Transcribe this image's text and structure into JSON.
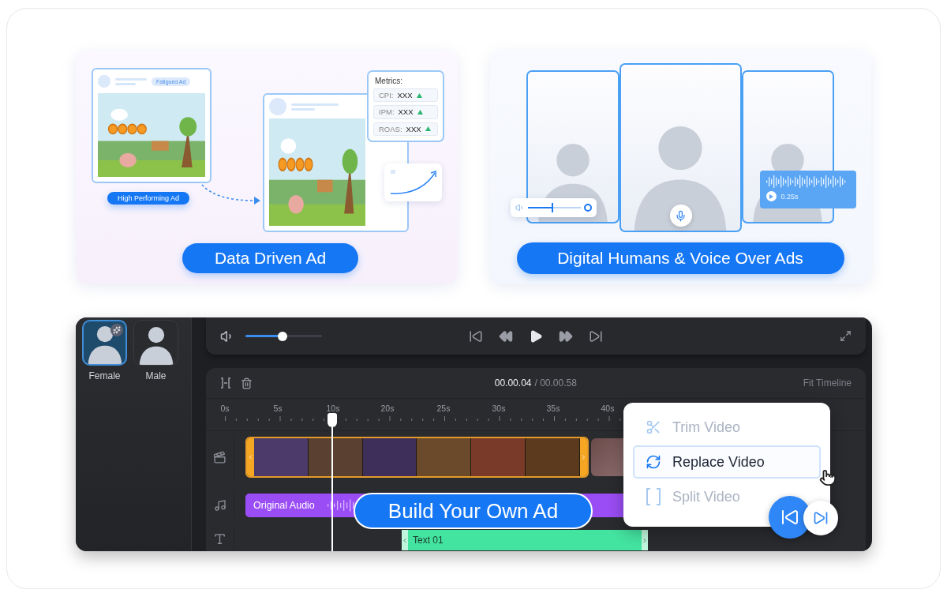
{
  "data_driven_card": {
    "fatigued_tag": "Fatigued Ad",
    "high_performing_label": "High Performing Ad",
    "metrics": {
      "title": "Metrics:",
      "rows": [
        {
          "label": "CPI:",
          "value": "XXX"
        },
        {
          "label": "IPM:",
          "value": "XXX"
        },
        {
          "label": "ROAS:",
          "value": "XXX"
        }
      ]
    },
    "button": "Data Driven Ad"
  },
  "digital_humans_card": {
    "volume": {
      "level": 0.45
    },
    "voice_duration": "0.25s",
    "button": "Digital Humans & Voice Over Ads"
  },
  "editor": {
    "avatars": [
      {
        "label": "Female",
        "selected": true
      },
      {
        "label": "Male",
        "selected": false
      }
    ],
    "player": {
      "volume": {
        "level": 0.48
      }
    },
    "timeline": {
      "current_time": "00.00.04",
      "total_time": "/ 00.00.58",
      "fit_label": "Fit Timeline",
      "ruler": [
        "0s",
        "5s",
        "10s",
        "20s",
        "25s",
        "30s",
        "35s",
        "40s"
      ],
      "tracks": [
        {
          "kind": "video"
        },
        {
          "kind": "audio",
          "label": "Original Audio"
        },
        {
          "kind": "text",
          "label": "Text 01"
        }
      ]
    },
    "context_menu": {
      "items": [
        {
          "kind": "trim",
          "label": "Trim Video",
          "disabled": true,
          "selected": false
        },
        {
          "kind": "replace",
          "label": "Replace Video",
          "disabled": false,
          "selected": true
        },
        {
          "kind": "split",
          "label": "Split Video",
          "disabled": true,
          "selected": false
        }
      ]
    },
    "banner": "Build Your Own Ad"
  }
}
